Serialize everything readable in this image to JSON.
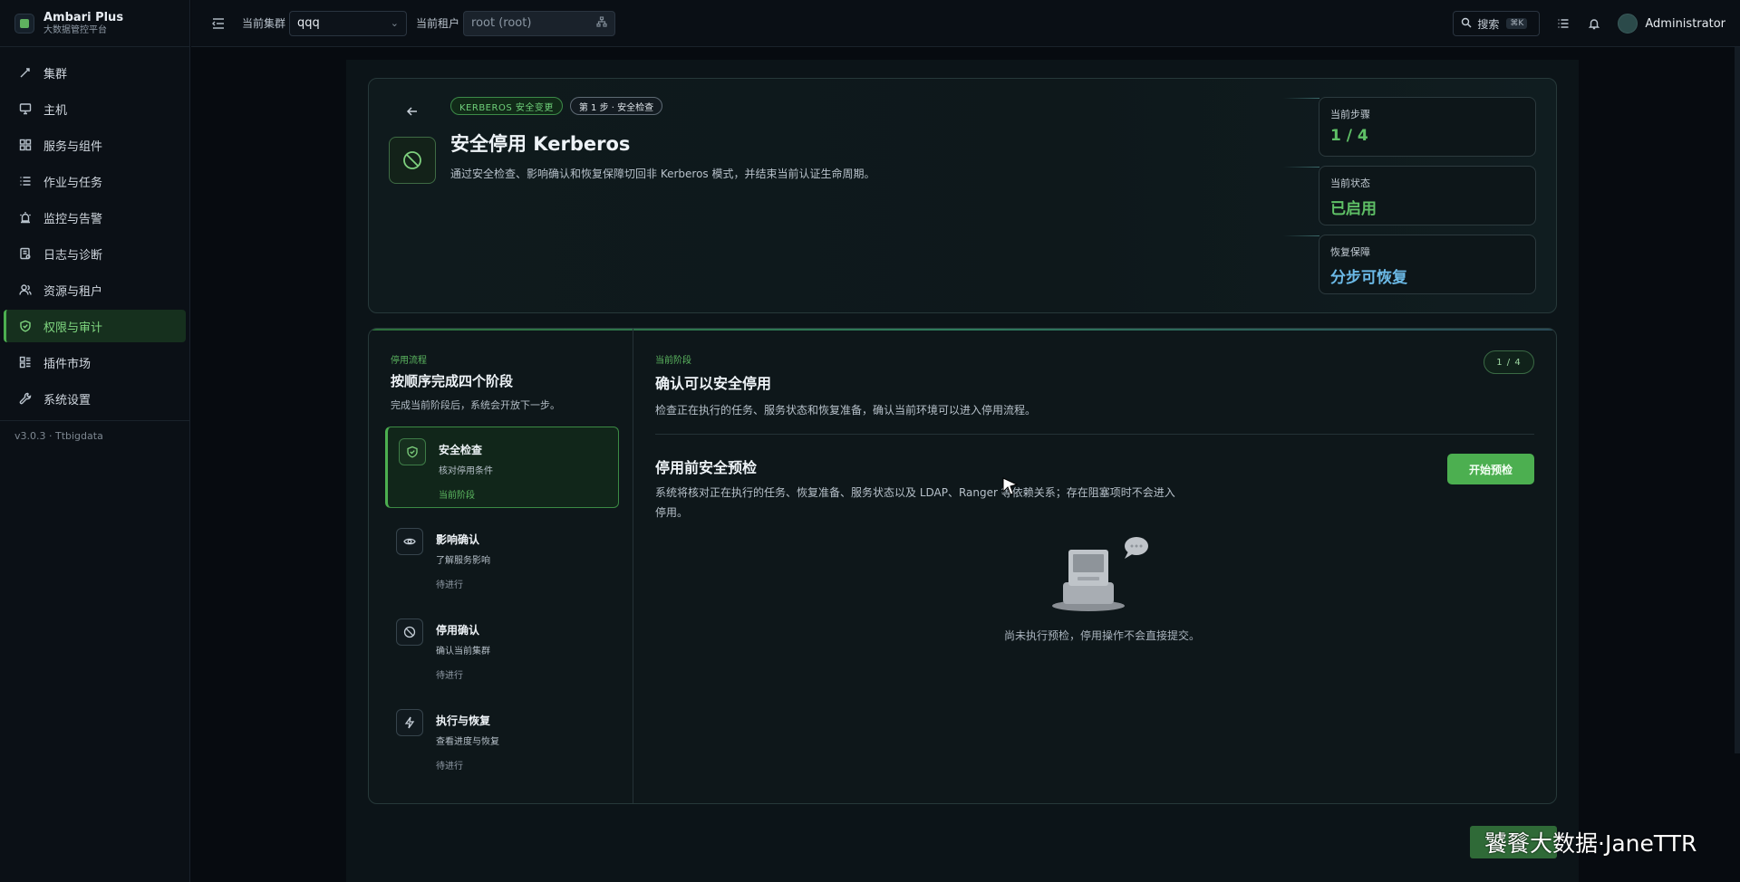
{
  "brand": {
    "title": "Ambari Plus",
    "subtitle": "大数据管控平台"
  },
  "sidebar": {
    "items": [
      {
        "label": "集群",
        "icon": "cluster-icon"
      },
      {
        "label": "主机",
        "icon": "monitor-icon"
      },
      {
        "label": "服务与组件",
        "icon": "grid-icon"
      },
      {
        "label": "作业与任务",
        "icon": "list-icon"
      },
      {
        "label": "监控与告警",
        "icon": "alarm-icon"
      },
      {
        "label": "日志与诊断",
        "icon": "log-icon"
      },
      {
        "label": "资源与租户",
        "icon": "users-icon"
      },
      {
        "label": "权限与审计",
        "icon": "shield-icon",
        "active": true
      },
      {
        "label": "插件市场",
        "icon": "plugin-icon"
      },
      {
        "label": "系统设置",
        "icon": "wrench-icon"
      }
    ],
    "version": "v3.0.3 · Ttbigdata"
  },
  "topbar": {
    "cluster_label": "当前集群",
    "cluster_value": "qqq",
    "tenant_label": "当前租户",
    "tenant_value": "root (root)",
    "search_label": "搜索",
    "search_kbd": "⌘K",
    "user": "Administrator"
  },
  "hero": {
    "tag_primary": "KERBEROS 安全变更",
    "tag_step": "第 1 步 · 安全检查",
    "title": "安全停用 Kerberos",
    "description": "通过安全检查、影响确认和恢复保障切回非 Kerberos 模式，并结束当前认证生命周期。",
    "stats": [
      {
        "label": "当前步骤",
        "value": "1 / 4",
        "color": "#5fc066"
      },
      {
        "label": "当前状态",
        "value": "已启用",
        "color": "#5fc066"
      },
      {
        "label": "恢复保障",
        "value": "分步可恢复",
        "color": "#6bb9e6"
      }
    ]
  },
  "flow": {
    "eyebrow": "停用流程",
    "title": "按顺序完成四个阶段",
    "subtitle": "完成当前阶段后，系统会开放下一步。",
    "steps": [
      {
        "name": "安全检查",
        "desc": "核对停用条件",
        "state": "当前阶段",
        "icon": "shield-check-icon"
      },
      {
        "name": "影响确认",
        "desc": "了解服务影响",
        "state": "待进行",
        "icon": "eye-icon"
      },
      {
        "name": "停用确认",
        "desc": "确认当前集群",
        "state": "待进行",
        "icon": "ban-icon"
      },
      {
        "name": "执行与恢复",
        "desc": "查看进度与恢复",
        "state": "待进行",
        "icon": "bolt-icon"
      }
    ]
  },
  "detail": {
    "eyebrow": "当前阶段",
    "title": "确认可以安全停用",
    "description": "检查正在执行的任务、服务状态和恢复准备，确认当前环境可以进入停用流程。",
    "counter": "1 / 4",
    "precheck_title": "停用前安全预检",
    "precheck_desc": "系统将核对正在执行的任务、恢复准备、服务状态以及 LDAP、Ranger 等依赖关系；存在阻塞项时不会进入停用。",
    "start_button": "开始预检",
    "empty_text": "尚未执行预检，停用操作不会直接提交。"
  },
  "watermark": "饕餮大数据·JaneTTR",
  "colors": {
    "accent": "#4caf50",
    "background": "#070b10",
    "panel": "#0e171a"
  }
}
